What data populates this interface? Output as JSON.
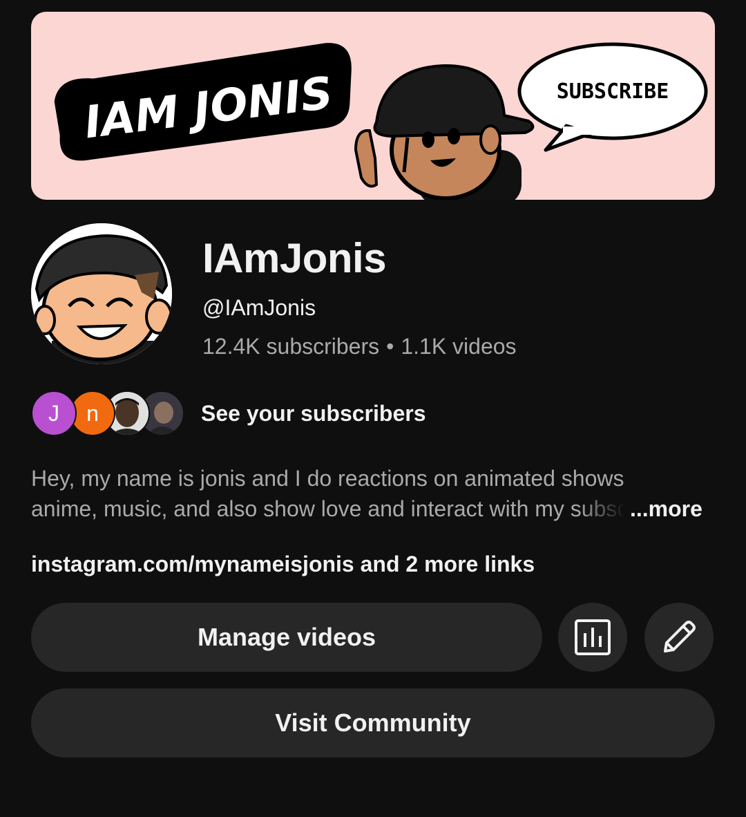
{
  "banner": {
    "title_text": "IAM JONIS",
    "bubble_text": "SUBSCRIBE"
  },
  "channel": {
    "name": "IAmJonis",
    "handle": "@IAmJonis",
    "subscribers": "12.4K subscribers",
    "separator": "•",
    "videos": "1.1K videos"
  },
  "subscribers_row": {
    "avatars": [
      {
        "letter": "J",
        "color": "#b94fd1"
      },
      {
        "letter": "n",
        "color": "#f26a10"
      }
    ],
    "label": "See your subscribers"
  },
  "description": {
    "line1": "Hey, my name is jonis and  I do reactions on animated shows,",
    "line2": "anime, music, and also show love and interact with my subscribers",
    "more_label": "...more"
  },
  "links_text": "instagram.com/mynameisjonis and 2 more links",
  "buttons": {
    "manage_videos": "Manage videos",
    "analytics_icon": "analytics-icon",
    "edit_icon": "pencil-icon",
    "visit_community": "Visit Community"
  },
  "colors": {
    "background": "#0f0f0f",
    "button_bg": "#272727",
    "banner_bg": "#fbd6d3",
    "secondary_text": "#aaaaaa"
  }
}
